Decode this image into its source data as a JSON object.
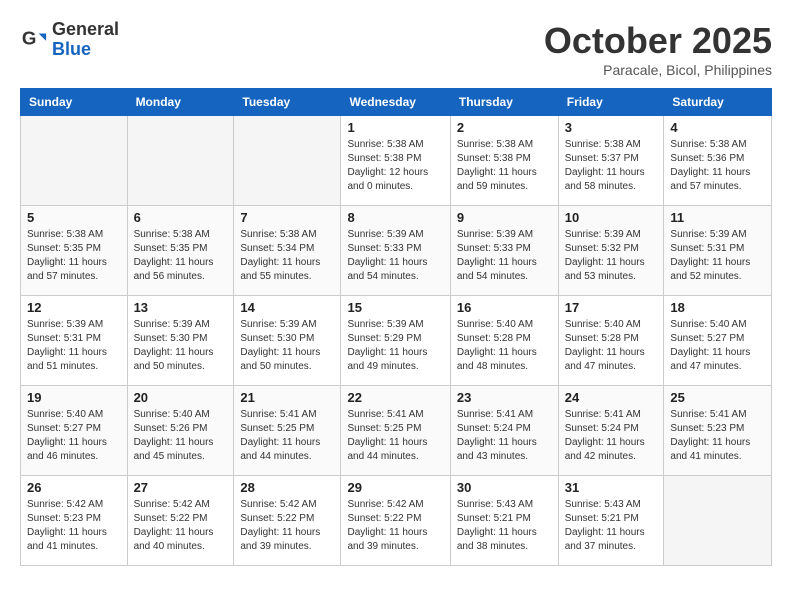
{
  "header": {
    "logo_general": "General",
    "logo_blue": "Blue",
    "month_title": "October 2025",
    "subtitle": "Paracale, Bicol, Philippines"
  },
  "days_of_week": [
    "Sunday",
    "Monday",
    "Tuesday",
    "Wednesday",
    "Thursday",
    "Friday",
    "Saturday"
  ],
  "weeks": [
    [
      {
        "day": "",
        "info": ""
      },
      {
        "day": "",
        "info": ""
      },
      {
        "day": "",
        "info": ""
      },
      {
        "day": "1",
        "info": "Sunrise: 5:38 AM\nSunset: 5:38 PM\nDaylight: 12 hours\nand 0 minutes."
      },
      {
        "day": "2",
        "info": "Sunrise: 5:38 AM\nSunset: 5:38 PM\nDaylight: 11 hours\nand 59 minutes."
      },
      {
        "day": "3",
        "info": "Sunrise: 5:38 AM\nSunset: 5:37 PM\nDaylight: 11 hours\nand 58 minutes."
      },
      {
        "day": "4",
        "info": "Sunrise: 5:38 AM\nSunset: 5:36 PM\nDaylight: 11 hours\nand 57 minutes."
      }
    ],
    [
      {
        "day": "5",
        "info": "Sunrise: 5:38 AM\nSunset: 5:35 PM\nDaylight: 11 hours\nand 57 minutes."
      },
      {
        "day": "6",
        "info": "Sunrise: 5:38 AM\nSunset: 5:35 PM\nDaylight: 11 hours\nand 56 minutes."
      },
      {
        "day": "7",
        "info": "Sunrise: 5:38 AM\nSunset: 5:34 PM\nDaylight: 11 hours\nand 55 minutes."
      },
      {
        "day": "8",
        "info": "Sunrise: 5:39 AM\nSunset: 5:33 PM\nDaylight: 11 hours\nand 54 minutes."
      },
      {
        "day": "9",
        "info": "Sunrise: 5:39 AM\nSunset: 5:33 PM\nDaylight: 11 hours\nand 54 minutes."
      },
      {
        "day": "10",
        "info": "Sunrise: 5:39 AM\nSunset: 5:32 PM\nDaylight: 11 hours\nand 53 minutes."
      },
      {
        "day": "11",
        "info": "Sunrise: 5:39 AM\nSunset: 5:31 PM\nDaylight: 11 hours\nand 52 minutes."
      }
    ],
    [
      {
        "day": "12",
        "info": "Sunrise: 5:39 AM\nSunset: 5:31 PM\nDaylight: 11 hours\nand 51 minutes."
      },
      {
        "day": "13",
        "info": "Sunrise: 5:39 AM\nSunset: 5:30 PM\nDaylight: 11 hours\nand 50 minutes."
      },
      {
        "day": "14",
        "info": "Sunrise: 5:39 AM\nSunset: 5:30 PM\nDaylight: 11 hours\nand 50 minutes."
      },
      {
        "day": "15",
        "info": "Sunrise: 5:39 AM\nSunset: 5:29 PM\nDaylight: 11 hours\nand 49 minutes."
      },
      {
        "day": "16",
        "info": "Sunrise: 5:40 AM\nSunset: 5:28 PM\nDaylight: 11 hours\nand 48 minutes."
      },
      {
        "day": "17",
        "info": "Sunrise: 5:40 AM\nSunset: 5:28 PM\nDaylight: 11 hours\nand 47 minutes."
      },
      {
        "day": "18",
        "info": "Sunrise: 5:40 AM\nSunset: 5:27 PM\nDaylight: 11 hours\nand 47 minutes."
      }
    ],
    [
      {
        "day": "19",
        "info": "Sunrise: 5:40 AM\nSunset: 5:27 PM\nDaylight: 11 hours\nand 46 minutes."
      },
      {
        "day": "20",
        "info": "Sunrise: 5:40 AM\nSunset: 5:26 PM\nDaylight: 11 hours\nand 45 minutes."
      },
      {
        "day": "21",
        "info": "Sunrise: 5:41 AM\nSunset: 5:25 PM\nDaylight: 11 hours\nand 44 minutes."
      },
      {
        "day": "22",
        "info": "Sunrise: 5:41 AM\nSunset: 5:25 PM\nDaylight: 11 hours\nand 44 minutes."
      },
      {
        "day": "23",
        "info": "Sunrise: 5:41 AM\nSunset: 5:24 PM\nDaylight: 11 hours\nand 43 minutes."
      },
      {
        "day": "24",
        "info": "Sunrise: 5:41 AM\nSunset: 5:24 PM\nDaylight: 11 hours\nand 42 minutes."
      },
      {
        "day": "25",
        "info": "Sunrise: 5:41 AM\nSunset: 5:23 PM\nDaylight: 11 hours\nand 41 minutes."
      }
    ],
    [
      {
        "day": "26",
        "info": "Sunrise: 5:42 AM\nSunset: 5:23 PM\nDaylight: 11 hours\nand 41 minutes."
      },
      {
        "day": "27",
        "info": "Sunrise: 5:42 AM\nSunset: 5:22 PM\nDaylight: 11 hours\nand 40 minutes."
      },
      {
        "day": "28",
        "info": "Sunrise: 5:42 AM\nSunset: 5:22 PM\nDaylight: 11 hours\nand 39 minutes."
      },
      {
        "day": "29",
        "info": "Sunrise: 5:42 AM\nSunset: 5:22 PM\nDaylight: 11 hours\nand 39 minutes."
      },
      {
        "day": "30",
        "info": "Sunrise: 5:43 AM\nSunset: 5:21 PM\nDaylight: 11 hours\nand 38 minutes."
      },
      {
        "day": "31",
        "info": "Sunrise: 5:43 AM\nSunset: 5:21 PM\nDaylight: 11 hours\nand 37 minutes."
      },
      {
        "day": "",
        "info": ""
      }
    ]
  ]
}
